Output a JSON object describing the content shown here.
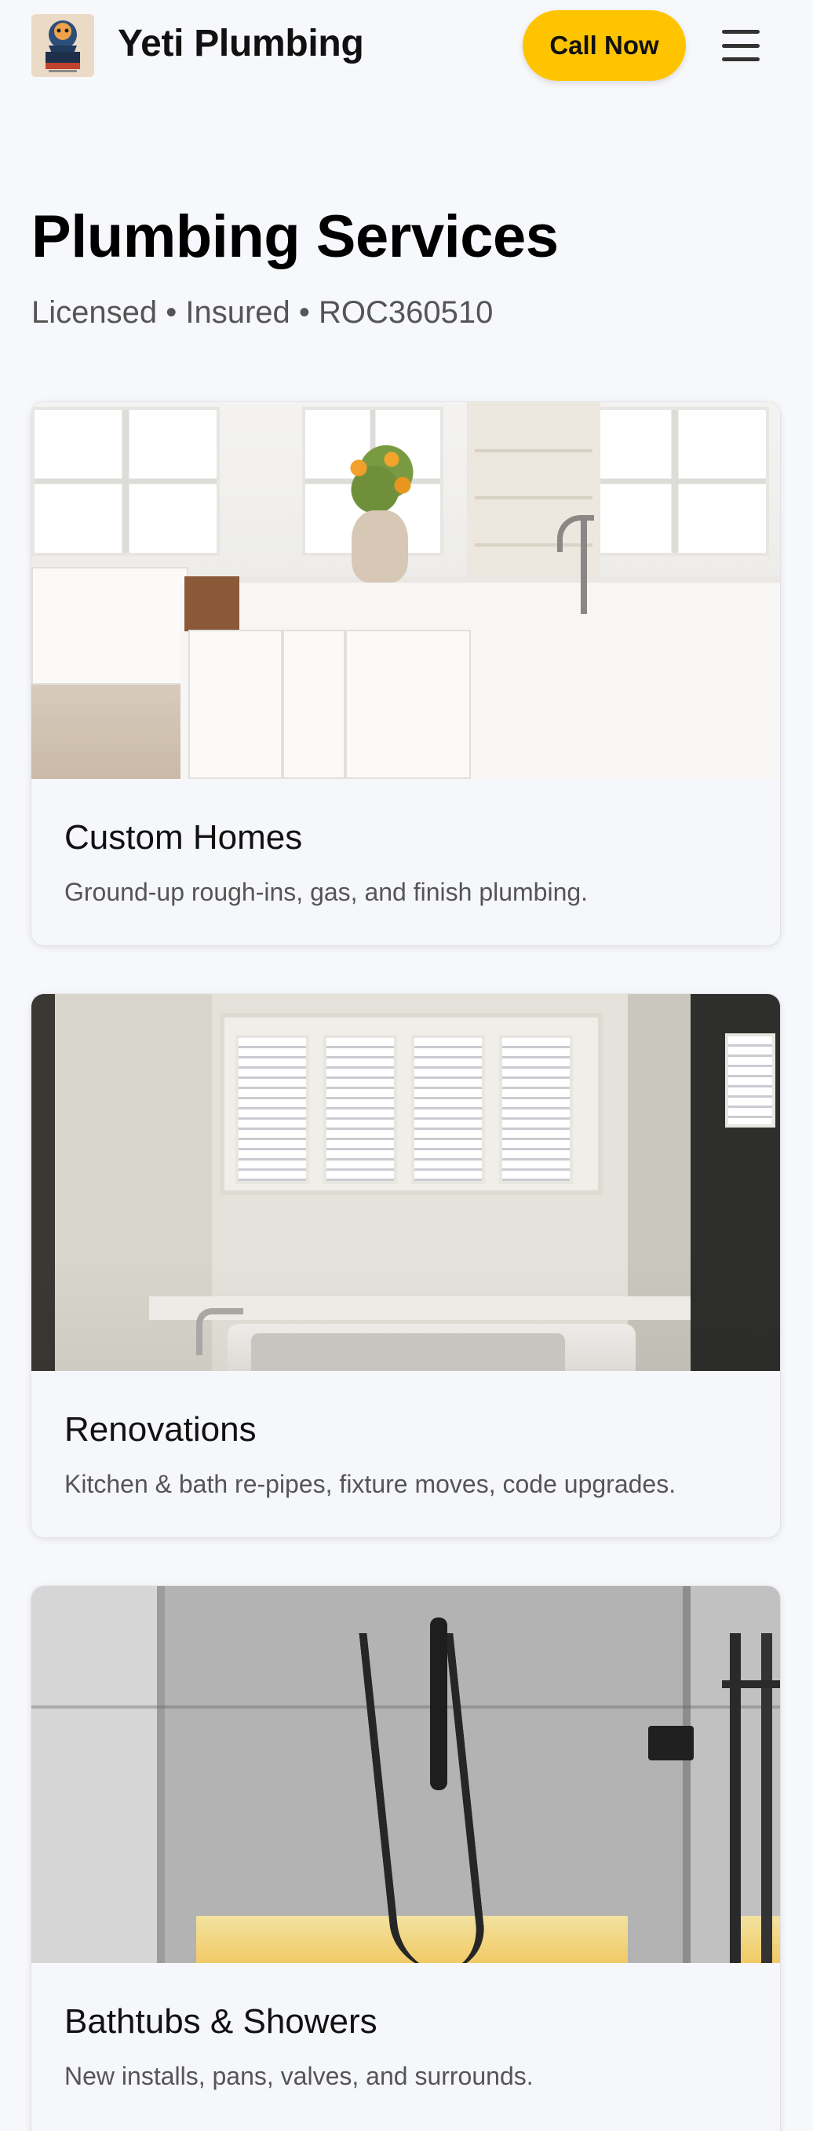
{
  "header": {
    "brand": "Yeti Plumbing",
    "logo_icon": "yeti-logo-icon",
    "call_label": "Call Now",
    "menu_icon": "hamburger-menu-icon"
  },
  "hero": {
    "title": "Plumbing Services",
    "subtitle": "Licensed • Insured • ROC360510"
  },
  "services": [
    {
      "title": "Custom Homes",
      "description": "Ground-up rough-ins, gas, and finish plumbing.",
      "image": "kitchen-island-photo"
    },
    {
      "title": "Renovations",
      "description": "Kitchen & bath re-pipes, fixture moves, code upgrades.",
      "image": "bathroom-tub-shutters-photo"
    },
    {
      "title": "Bathtubs & Showers",
      "description": "New installs, pans, valves, and surrounds.",
      "image": "shower-fixture-photo"
    }
  ],
  "colors": {
    "accent": "#ffc400",
    "background": "#f7f8fb",
    "text": "#111111",
    "muted": "#555555"
  }
}
